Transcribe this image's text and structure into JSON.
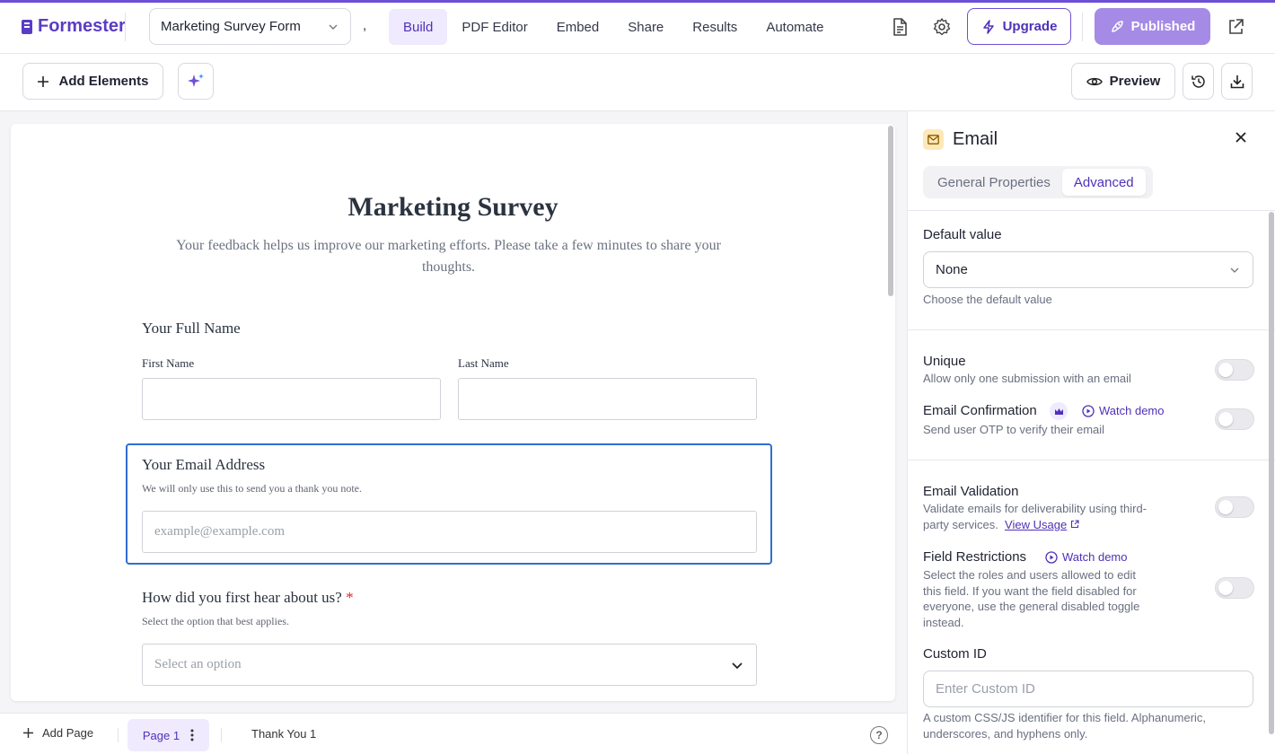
{
  "app": {
    "name": "Formester"
  },
  "header": {
    "form_name": "Marketing Survey Form",
    "separator": ",",
    "nav": [
      "Build",
      "PDF Editor",
      "Embed",
      "Share",
      "Results",
      "Automate"
    ],
    "active_nav": "Build",
    "upgrade_label": "Upgrade",
    "published_label": "Published"
  },
  "toolbar": {
    "add_elements_label": "Add Elements",
    "preview_label": "Preview"
  },
  "form": {
    "title": "Marketing Survey",
    "description": "Your feedback helps us improve our marketing efforts. Please take a few minutes to share your thoughts.",
    "full_name": {
      "label": "Your Full Name",
      "first_label": "First Name",
      "last_label": "Last Name"
    },
    "email": {
      "label": "Your Email Address",
      "help": "We will only use this to send you a thank you note.",
      "placeholder": "example@example.com"
    },
    "source": {
      "label": "How did you first hear about us?",
      "required_mark": "*",
      "help": "Select the option that best applies.",
      "placeholder": "Select an option"
    }
  },
  "footer": {
    "add_page_label": "Add Page",
    "pages": [
      "Page 1",
      "Thank You 1"
    ],
    "help_label": "?"
  },
  "panel": {
    "title": "Email",
    "tabs": [
      "General Properties",
      "Advanced"
    ],
    "active_tab": "Advanced",
    "default_value": {
      "label": "Default value",
      "selected": "None",
      "help": "Choose the default value"
    },
    "unique": {
      "label": "Unique",
      "help": "Allow only one submission with an email",
      "enabled": false
    },
    "email_confirmation": {
      "label": "Email Confirmation",
      "watch_label": "Watch demo",
      "help": "Send user OTP to verify their email",
      "enabled": false
    },
    "email_validation": {
      "label": "Email Validation",
      "help_line1": "Validate emails for deliverability using third-",
      "help_line2": "party services.",
      "link_label": "View Usage",
      "enabled": false
    },
    "field_restrictions": {
      "label": "Field Restrictions",
      "watch_label": "Watch demo",
      "help_lines": [
        "Select the roles and users allowed to edit",
        "this field. If you want the field disabled for",
        "everyone, use the general disabled toggle",
        "instead."
      ],
      "enabled": false
    },
    "custom_id": {
      "label": "Custom ID",
      "placeholder": "Enter Custom ID",
      "help_lines": [
        "A custom CSS/JS identifier for this field. Alphanumeric,",
        "underscores, and hyphens only."
      ]
    }
  },
  "colors": {
    "brand": "#5b3cc4",
    "accent_bg": "#efeafd",
    "selection": "#2f6fd1",
    "required": "#dc2626"
  }
}
